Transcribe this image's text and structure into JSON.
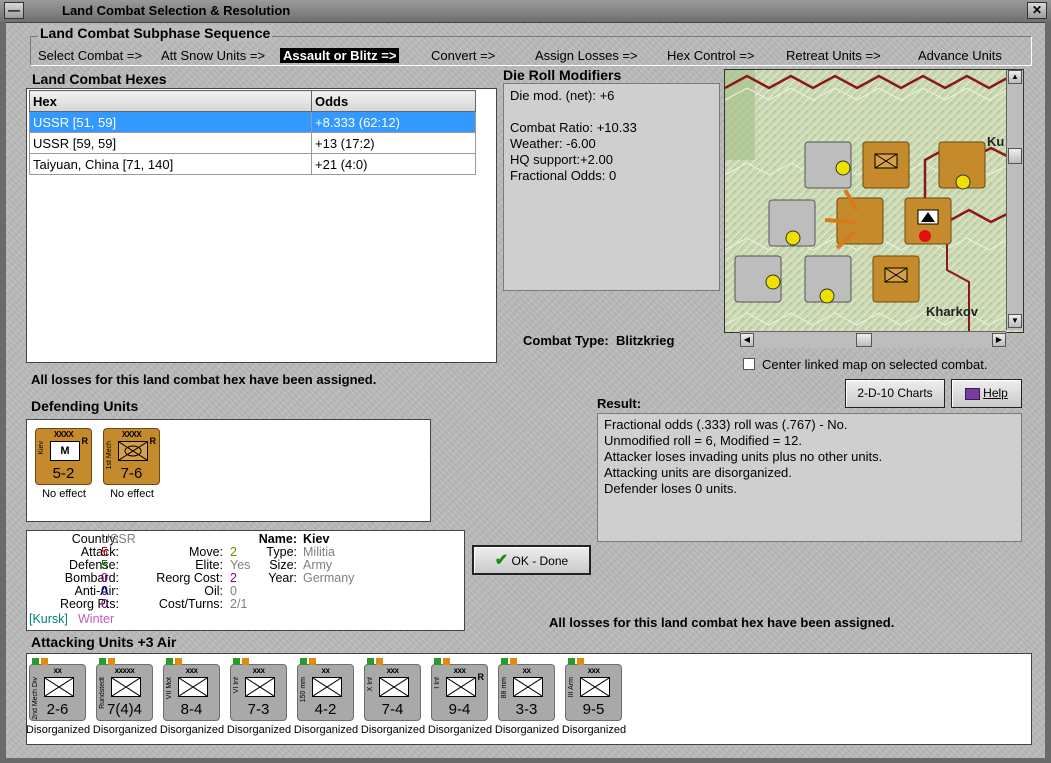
{
  "window": {
    "title": "Land Combat Selection & Resolution"
  },
  "sequence": {
    "title": "Land Combat Subphase Sequence",
    "steps": [
      {
        "label": "Select Combat =>"
      },
      {
        "label": "Att Snow Units =>"
      },
      {
        "label": "Assault or Blitz =>",
        "active": true
      },
      {
        "label": "Convert =>"
      },
      {
        "label": "Assign Losses =>"
      },
      {
        "label": "Hex Control =>"
      },
      {
        "label": "Retreat Units =>"
      },
      {
        "label": "Advance Units"
      }
    ]
  },
  "hexes": {
    "title": "Land Combat Hexes",
    "columns": [
      "Hex",
      "Odds"
    ],
    "rows": [
      {
        "hex": "USSR [51, 59]",
        "odds": "+8.333 (62:12)",
        "selected": true
      },
      {
        "hex": "USSR [59, 59]",
        "odds": "+13 (17:2)"
      },
      {
        "hex": "Taiyuan, China [71, 140]",
        "odds": "+21 (4:0)"
      }
    ]
  },
  "modifiers": {
    "title": "Die Roll Modifiers",
    "lines": [
      "Die mod. (net): +6",
      "",
      "Combat Ratio: +10.33",
      "Weather: -6.00",
      "HQ support:+2.00",
      "Fractional Odds: 0"
    ]
  },
  "combat_type": {
    "label": "Combat Type:",
    "value": "Blitzkrieg"
  },
  "map": {
    "labels": [
      "Ku",
      "Kharkov"
    ],
    "center_checkbox_label": "Center linked map on selected combat.",
    "center_checked": false
  },
  "losses_msg_top": "All losses for this land combat hex have been assigned.",
  "losses_msg_bottom": "All losses for this land combat hex have been assigned.",
  "buttons": {
    "charts": "2-D-10 Charts",
    "help": "Help",
    "ok": "OK - Done"
  },
  "result": {
    "title": "Result:",
    "lines": [
      "Fractional odds (.333) roll was (.767)  - No.",
      "Unmodified roll = 6, Modified = 12.",
      "Attacker loses invading units plus no other units.",
      "Attacking units are disorganized.",
      "Defender loses 0 units."
    ]
  },
  "defending": {
    "title": "Defending Units",
    "units": [
      {
        "size": "XXXX",
        "side": "Kiev",
        "strength": "5-2",
        "r": "R",
        "symbol": "M",
        "status": "No effect"
      },
      {
        "size": "XXXX",
        "side": "1st Mech",
        "strength": "7-6",
        "r": "R",
        "symbol": "",
        "status": "No effect"
      }
    ]
  },
  "unit_info": {
    "country_label": "Country:",
    "country": "USSR",
    "attack_label": "Attack:",
    "attack": "5",
    "defense_label": "Defense:",
    "defense": "5",
    "bombard_label": "Bombard:",
    "bombard": "0",
    "antiair_label": "Anti-Air:",
    "antiair": "0",
    "reorgpts_label": "Reorg Pts:",
    "reorgpts": "0",
    "location": "[Kursk]",
    "weather": "Winter",
    "move_label": "Move:",
    "move": "2",
    "elite_label": "Elite:",
    "elite": "Yes",
    "reorgcost_label": "Reorg Cost:",
    "reorgcost": "2",
    "oil_label": "Oil:",
    "oil": "0",
    "costturns_label": "Cost/Turns:",
    "costturns": "2/1",
    "name_label": "Name:",
    "name": "Kiev",
    "type_label": "Type:",
    "type": "Militia",
    "sizef_label": "Size:",
    "sizef": "Army",
    "year_label": "Year:",
    "year": "Germany"
  },
  "attacking": {
    "title": "Attacking Units +3 Air",
    "units": [
      {
        "size": "xx",
        "side": "2nd Mech Div",
        "strength": "2-6",
        "status": "Disorganized"
      },
      {
        "size": "xxxxx",
        "side": "Rundstedt",
        "strength": "7(4)4",
        "status": "Disorganized"
      },
      {
        "size": "xxx",
        "side": "VII Mot",
        "strength": "8-4",
        "status": "Disorganized"
      },
      {
        "size": "xxx",
        "side": "VI Inf",
        "strength": "7-3",
        "status": "Disorganized"
      },
      {
        "size": "xx",
        "side": "150 mm",
        "strength": "4-2",
        "status": "Disorganized"
      },
      {
        "size": "xxx",
        "side": "X Inf",
        "strength": "7-4",
        "status": "Disorganized"
      },
      {
        "size": "xxx",
        "side": "I Inf",
        "strength": "9-4",
        "r": "R",
        "status": "Disorganized"
      },
      {
        "size": "xx",
        "side": "88 mm",
        "strength": "3-3",
        "status": "Disorganized"
      },
      {
        "size": "xxx",
        "side": "III Arm",
        "strength": "9-5",
        "status": "Disorganized"
      }
    ]
  },
  "colors": {
    "selection": "#3399ff",
    "orange_counter": "#c48a2c",
    "red_value": "#c00000",
    "green_value": "#008000",
    "purple_value": "#8b008b",
    "blue_value": "#0000c0"
  }
}
